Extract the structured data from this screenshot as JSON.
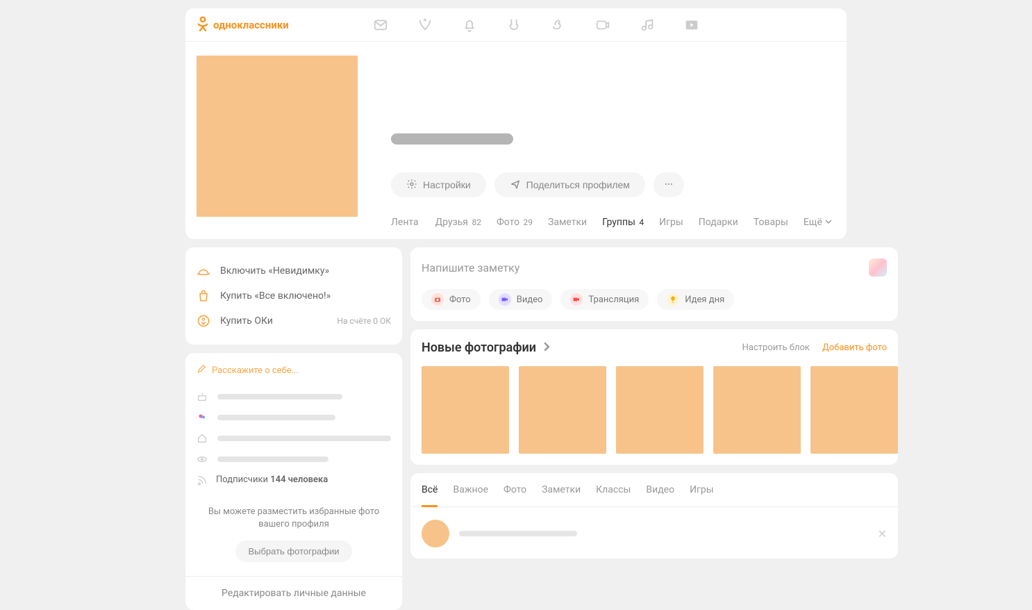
{
  "brand": {
    "name": "одноклассники"
  },
  "profile": {
    "settings_label": "Настройки",
    "share_label": "Поделиться профилем",
    "tabs": [
      {
        "label": "Лента",
        "count": ""
      },
      {
        "label": "Друзья",
        "count": "82"
      },
      {
        "label": "Фото",
        "count": "29"
      },
      {
        "label": "Заметки",
        "count": ""
      },
      {
        "label": "Группы",
        "count": "4",
        "active": true
      },
      {
        "label": "Игры",
        "count": ""
      },
      {
        "label": "Подарки",
        "count": ""
      },
      {
        "label": "Товары",
        "count": ""
      }
    ],
    "more_label": "Ещё"
  },
  "quick": {
    "invisible": "Включить «Невидимку»",
    "all_inclusive": "Купить «Все включено!»",
    "buy_oks": "Купить ОКи",
    "balance_label": "На счёте 0 ОК"
  },
  "about": {
    "edit_prompt": "Расскажите о себе...",
    "subscribers_prefix": "Подписчики",
    "subscribers_count": "144 человека",
    "note": "Вы можете разместить избранные фото вашего профиля",
    "choose_photos": "Выбрать фотографии",
    "edit_link": "Редактировать личные данные"
  },
  "composer": {
    "placeholder": "Напишите заметку",
    "chips": {
      "photo": "Фото",
      "video": "Видео",
      "live": "Трансляция",
      "idea": "Идея дня"
    }
  },
  "photos": {
    "title": "Новые фотографии",
    "configure": "Настроить блок",
    "add": "Добавить фото"
  },
  "feed": {
    "tabs": [
      "Всё",
      "Важное",
      "Фото",
      "Заметки",
      "Классы",
      "Видео",
      "Игры"
    ]
  }
}
